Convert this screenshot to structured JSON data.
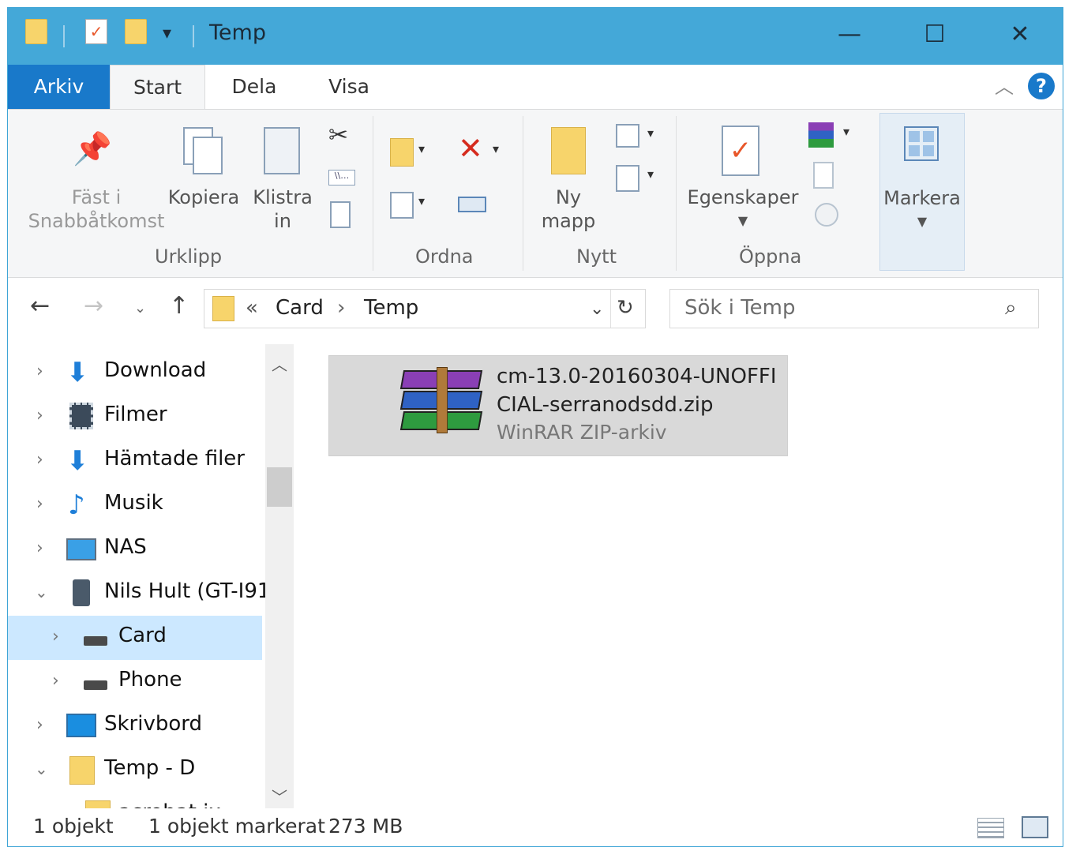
{
  "window": {
    "title": "Temp",
    "minimize": "—",
    "maximize": "☐",
    "close": "✕"
  },
  "tabs": {
    "arkiv": "Arkiv",
    "start": "Start",
    "dela": "Dela",
    "visa": "Visa"
  },
  "help": "?",
  "ribbon": {
    "pin_line1": "Fäst i",
    "pin_line2": "Snabbåtkomst",
    "copy": "Kopiera",
    "paste_line1": "Klistra",
    "paste_line2": "in",
    "group_clipboard": "Urklipp",
    "group_organize": "Ordna",
    "new_folder_line1": "Ny",
    "new_folder_line2": "mapp",
    "group_new": "Nytt",
    "properties": "Egenskaper",
    "group_open": "Öppna",
    "select": "Markera"
  },
  "address": {
    "overflow": "«",
    "crumbs": [
      "Card",
      "Temp"
    ],
    "separator": "›",
    "search_placeholder": "Sök i Temp"
  },
  "nav": {
    "items": [
      {
        "label": "Download"
      },
      {
        "label": "Filmer"
      },
      {
        "label": "Hämtade filer"
      },
      {
        "label": "Musik"
      },
      {
        "label": "NAS"
      },
      {
        "label": "Nils Hult (GT-I91"
      },
      {
        "label": "Card"
      },
      {
        "label": "Phone"
      },
      {
        "label": "Skrivbord"
      },
      {
        "label": "Temp - D"
      },
      {
        "label": "acrobat ix"
      }
    ]
  },
  "file": {
    "name": "cm-13.0-20160304-UNOFFICIAL-serranodsdd.zip",
    "type": "WinRAR ZIP-arkiv"
  },
  "status": {
    "count": "1 objekt",
    "selected": "1 objekt markerat",
    "size": "273 MB"
  },
  "colors": {
    "accent": "#1979ca",
    "titlebar": "#44a8d8",
    "selection": "#cce8ff"
  }
}
